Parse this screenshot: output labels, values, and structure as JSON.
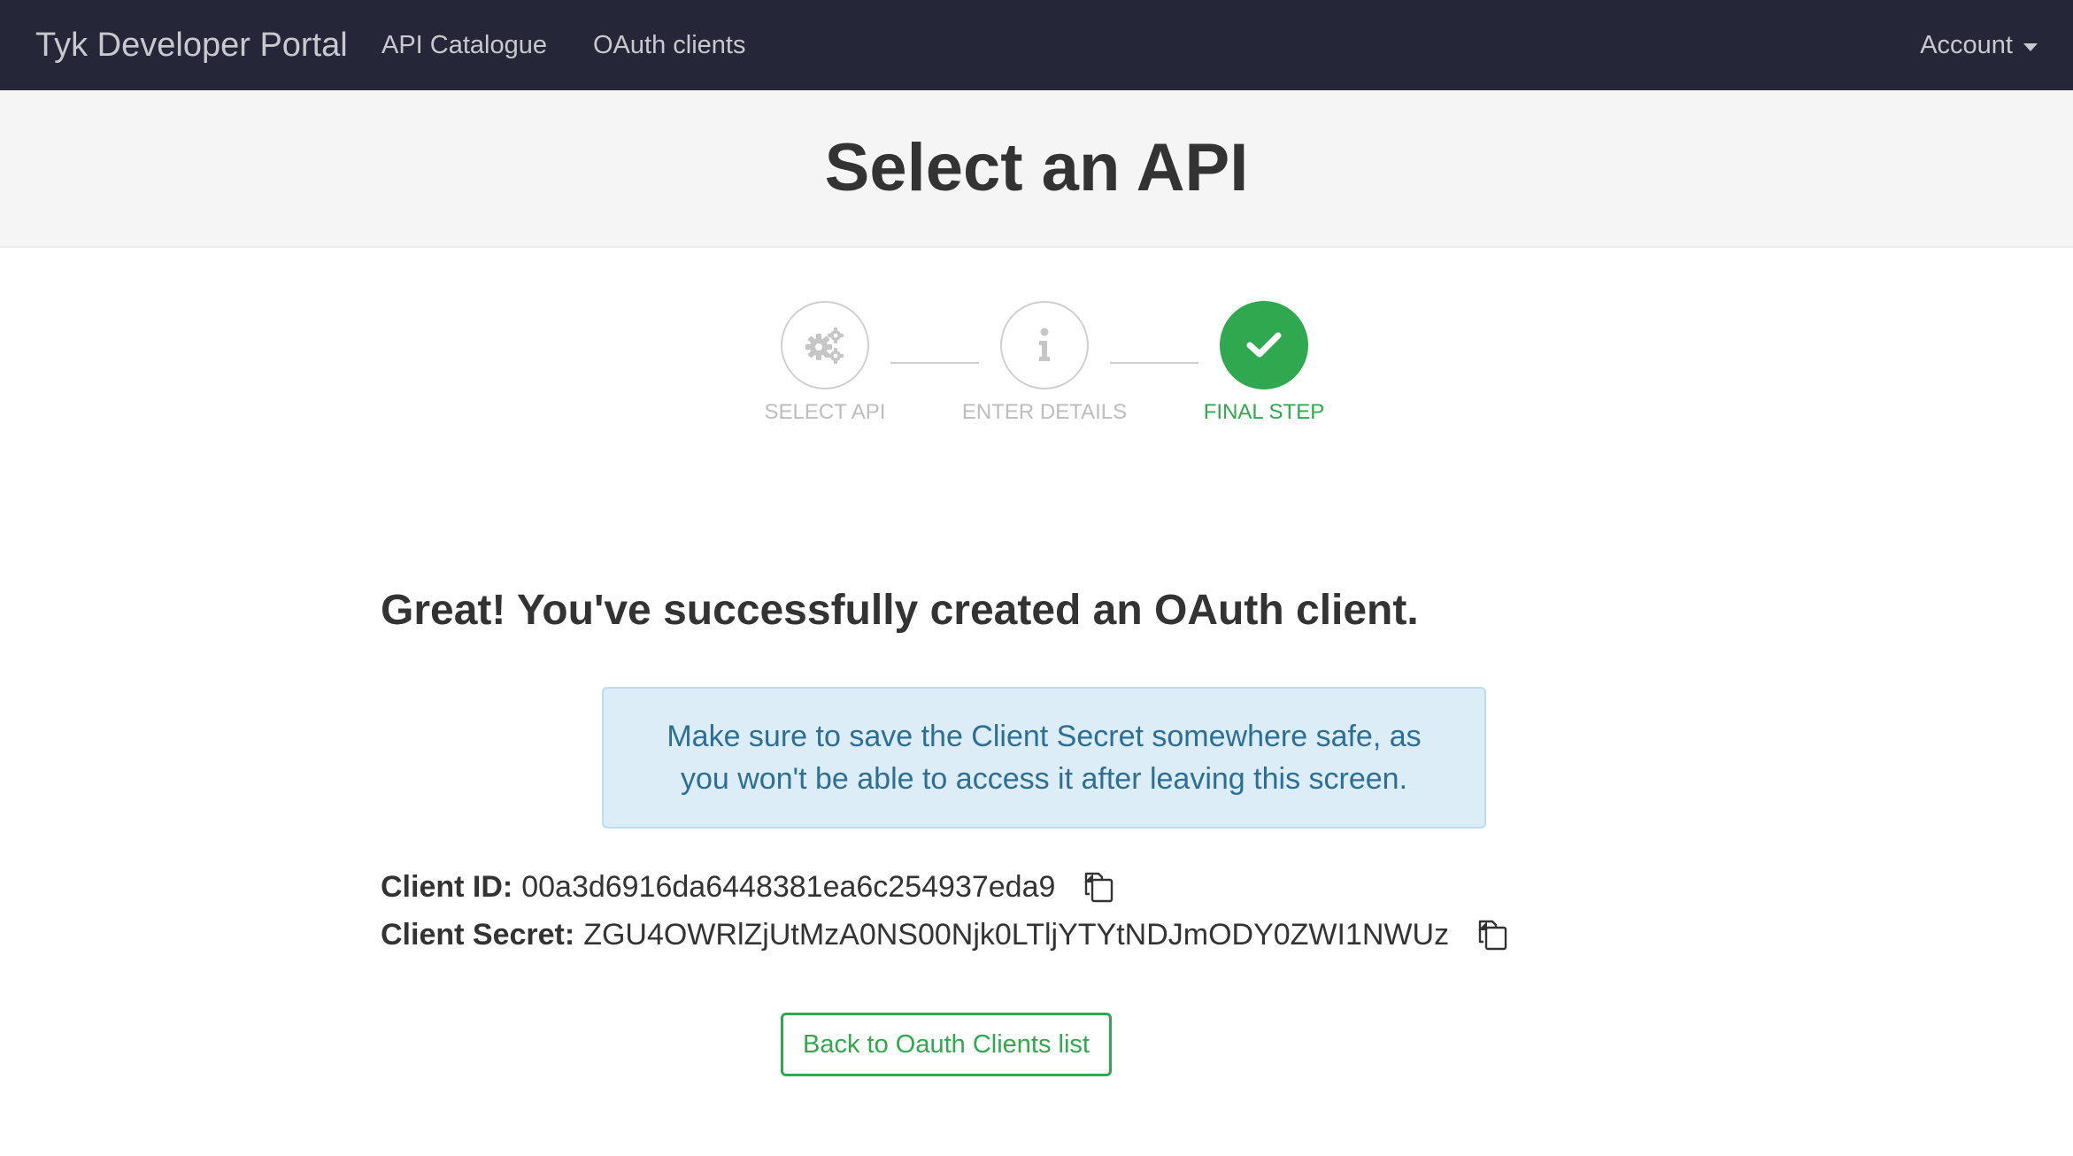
{
  "navbar": {
    "brand": "Tyk Developer Portal",
    "links": {
      "catalogue": "API Catalogue",
      "oauth_clients": "OAuth clients"
    },
    "account": "Account"
  },
  "header": {
    "title": "Select an API"
  },
  "stepper": {
    "steps": [
      {
        "label": "SELECT API",
        "icon": "gears-icon",
        "state": "inactive"
      },
      {
        "label": "ENTER DETAILS",
        "icon": "info-icon",
        "state": "inactive"
      },
      {
        "label": "FINAL STEP",
        "icon": "check-icon",
        "state": "complete"
      }
    ]
  },
  "main": {
    "success_message": "Great! You've successfully created an OAuth client.",
    "alert": "Make sure to save the Client Secret somewhere safe, as you won't be able to access it after leaving this screen.",
    "client_id": {
      "label": "Client ID:",
      "value": "00a3d6916da6448381ea6c254937eda9"
    },
    "client_secret": {
      "label": "Client Secret:",
      "value": "ZGU4OWRlZjUtMzA0NS00Njk0LTljYTYtNDJmODY0ZWI1NWUz"
    },
    "back_button": "Back to Oauth Clients list"
  },
  "colors": {
    "navbar_bg": "#262639",
    "success_green": "#2fa84f",
    "alert_bg": "#dcedf8",
    "alert_text": "#2d6e95"
  }
}
